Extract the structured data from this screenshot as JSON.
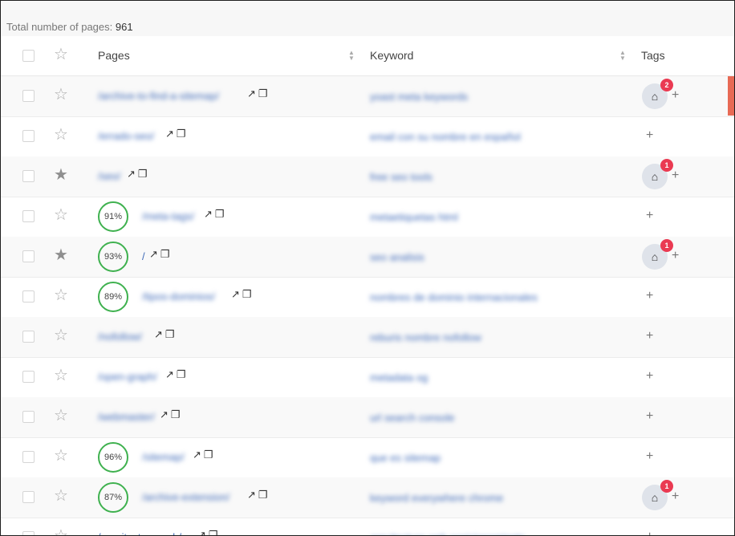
{
  "summary": {
    "label": "Total number of pages:",
    "count": "961"
  },
  "columns": {
    "pages": "Pages",
    "keyword": "Keyword",
    "tags": "Tags"
  },
  "icons": {
    "external": "external-link-icon",
    "copy": "copy-icon",
    "tag": "tag-icon",
    "star": "star-icon",
    "plus": "plus-icon",
    "sort": "sort-icon"
  },
  "colors": {
    "score_ring": "#3fb14f",
    "badge": "#ea3a52",
    "link": "#3f6ab8",
    "scroll_marker": "#e86a55"
  },
  "rows": [
    {
      "page": "/archive-to-find-a-sitemap/",
      "keyword": "yoast meta keywords",
      "starred": false,
      "score": "",
      "tags": "2"
    },
    {
      "page": "/errado-seo/",
      "keyword": "email con su nombre en español",
      "starred": false,
      "score": "",
      "tags": ""
    },
    {
      "page": "/seo/",
      "keyword": "free seo tools",
      "starred": true,
      "score": "",
      "tags": "1"
    },
    {
      "page": "/meta-tags/",
      "keyword": "metaetiquetas html",
      "starred": false,
      "score": "91%",
      "tags": ""
    },
    {
      "page": "/",
      "keyword": "seo analisis",
      "starred": true,
      "score": "93%",
      "tags": "1"
    },
    {
      "page": "/tipos-dominios/",
      "keyword": "nombres de dominio internacionales",
      "starred": false,
      "score": "89%",
      "tags": ""
    },
    {
      "page": "/nofollow/",
      "keyword": "reburis nombre nofollow",
      "starred": false,
      "score": "",
      "tags": ""
    },
    {
      "page": "/open-graph/",
      "keyword": "metadata og",
      "starred": false,
      "score": "",
      "tags": ""
    },
    {
      "page": "/webmaster/",
      "keyword": "url search console",
      "starred": false,
      "score": "",
      "tags": ""
    },
    {
      "page": "/sitemap/",
      "keyword": "que es sitemap",
      "starred": false,
      "score": "96%",
      "tags": ""
    },
    {
      "page": "/archive-extension/",
      "keyword": "keyword everywhere chrome",
      "starred": false,
      "score": "87%",
      "tags": "1"
    },
    {
      "page": "/arquitectura-web/",
      "keyword": "arquitectura web posicionamiento",
      "starred": false,
      "score": "",
      "tags": ""
    }
  ]
}
